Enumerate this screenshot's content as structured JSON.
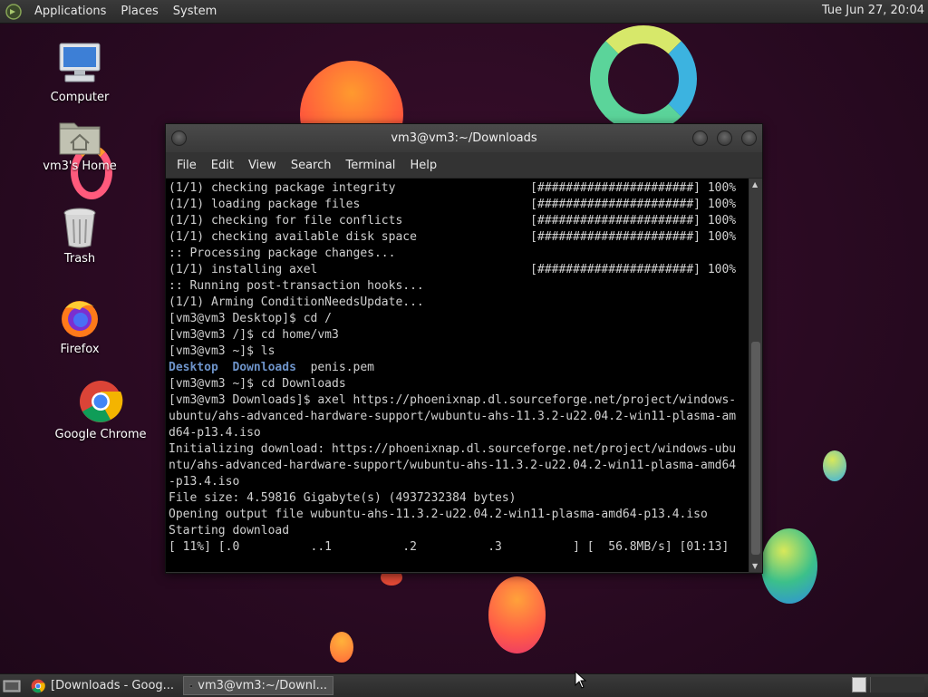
{
  "top_panel": {
    "menus": [
      "Applications",
      "Places",
      "System"
    ],
    "clock": "Tue Jun 27, 20:04"
  },
  "desktop": {
    "icons": [
      {
        "label": "Computer",
        "icon": "computer-icon"
      },
      {
        "label": "vm3's Home",
        "icon": "home-folder-icon"
      },
      {
        "label": "Trash",
        "icon": "trash-icon"
      },
      {
        "label": "Firefox",
        "icon": "firefox-icon"
      },
      {
        "label": "Google Chrome",
        "icon": "chrome-icon"
      }
    ]
  },
  "window": {
    "title": "vm3@vm3:~/Downloads",
    "menu": [
      "File",
      "Edit",
      "View",
      "Search",
      "Terminal",
      "Help"
    ],
    "terminal_lines": [
      "(1/1) checking package integrity                   [######################] 100%",
      "(1/1) loading package files                        [######################] 100%",
      "(1/1) checking for file conflicts                  [######################] 100%",
      "(1/1) checking available disk space                [######################] 100%",
      ":: Processing package changes...",
      "(1/1) installing axel                              [######################] 100%",
      ":: Running post-transaction hooks...",
      "(1/1) Arming ConditionNeedsUpdate...",
      "[vm3@vm3 Desktop]$ cd /",
      "[vm3@vm3 /]$ cd home/vm3",
      "[vm3@vm3 ~]$ ls"
    ],
    "ls_output": {
      "dir1": "Desktop",
      "dir2": "Downloads",
      "file": "penis.pem"
    },
    "terminal_lines_2": [
      "[vm3@vm3 ~]$ cd Downloads",
      "[vm3@vm3 Downloads]$ axel https://phoenixnap.dl.sourceforge.net/project/windows-",
      "ubuntu/ahs-advanced-hardware-support/wubuntu-ahs-11.3.2-u22.04.2-win11-plasma-am",
      "d64-p13.4.iso",
      "Initializing download: https://phoenixnap.dl.sourceforge.net/project/windows-ubu",
      "ntu/ahs-advanced-hardware-support/wubuntu-ahs-11.3.2-u22.04.2-win11-plasma-amd64",
      "-p13.4.iso",
      "File size: 4.59816 Gigabyte(s) (4937232384 bytes)",
      "Opening output file wubuntu-ahs-11.3.2-u22.04.2-win11-plasma-amd64-p13.4.iso",
      "Starting download",
      "",
      "[ 11%] [.0          ..1          .2          .3          ] [  56.8MB/s] [01:13]"
    ]
  },
  "taskbar": {
    "tasks": [
      {
        "label": "[Downloads - Goog...",
        "icon": "chrome-icon",
        "active": false
      },
      {
        "label": "vm3@vm3:~/Downl...",
        "icon": "terminal-icon",
        "active": true
      }
    ]
  },
  "colors": {
    "background": "#2a0a22",
    "directory": "#6d93c9",
    "terminal_bg": "#000000",
    "terminal_fg": "#d0d0d0"
  }
}
